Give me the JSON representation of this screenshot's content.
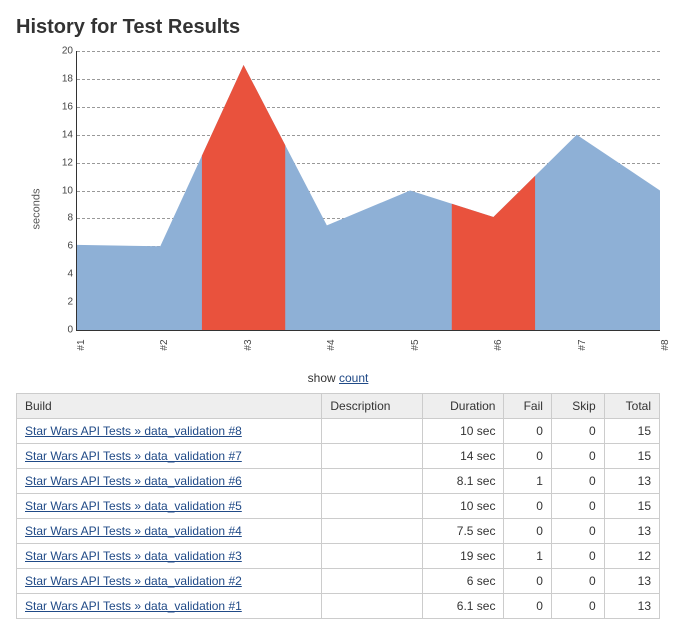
{
  "page_title": "History for Test Results",
  "chart_data": {
    "type": "area",
    "ylabel": "seconds",
    "ylim": [
      0,
      20
    ],
    "yticks": [
      0,
      2,
      4,
      6,
      8,
      10,
      12,
      14,
      16,
      18,
      20
    ],
    "categories": [
      "#1",
      "#2",
      "#3",
      "#4",
      "#5",
      "#6",
      "#7",
      "#8"
    ],
    "values": [
      6.1,
      6,
      19,
      7.5,
      10,
      8.1,
      14,
      10
    ],
    "fail_indices": [
      2,
      5
    ],
    "colors": {
      "normal": "#8eb0d6",
      "fail": "#e9523d"
    }
  },
  "show_text": "show ",
  "show_link": "count",
  "table": {
    "headers": {
      "build": "Build",
      "description": "Description",
      "duration": "Duration",
      "fail": "Fail",
      "skip": "Skip",
      "total": "Total"
    },
    "rows": [
      {
        "build": "Star Wars API Tests » data_validation #8",
        "description": "",
        "duration": "10 sec",
        "fail": 0,
        "skip": 0,
        "total": 15
      },
      {
        "build": "Star Wars API Tests » data_validation #7",
        "description": "",
        "duration": "14 sec",
        "fail": 0,
        "skip": 0,
        "total": 15
      },
      {
        "build": "Star Wars API Tests » data_validation #6",
        "description": "",
        "duration": "8.1 sec",
        "fail": 1,
        "skip": 0,
        "total": 13
      },
      {
        "build": "Star Wars API Tests » data_validation #5",
        "description": "",
        "duration": "10 sec",
        "fail": 0,
        "skip": 0,
        "total": 15
      },
      {
        "build": "Star Wars API Tests » data_validation #4",
        "description": "",
        "duration": "7.5 sec",
        "fail": 0,
        "skip": 0,
        "total": 13
      },
      {
        "build": "Star Wars API Tests » data_validation #3",
        "description": "",
        "duration": "19 sec",
        "fail": 1,
        "skip": 0,
        "total": 12
      },
      {
        "build": "Star Wars API Tests » data_validation #2",
        "description": "",
        "duration": "6 sec",
        "fail": 0,
        "skip": 0,
        "total": 13
      },
      {
        "build": "Star Wars API Tests » data_validation #1",
        "description": "",
        "duration": "6.1 sec",
        "fail": 0,
        "skip": 0,
        "total": 13
      }
    ]
  }
}
